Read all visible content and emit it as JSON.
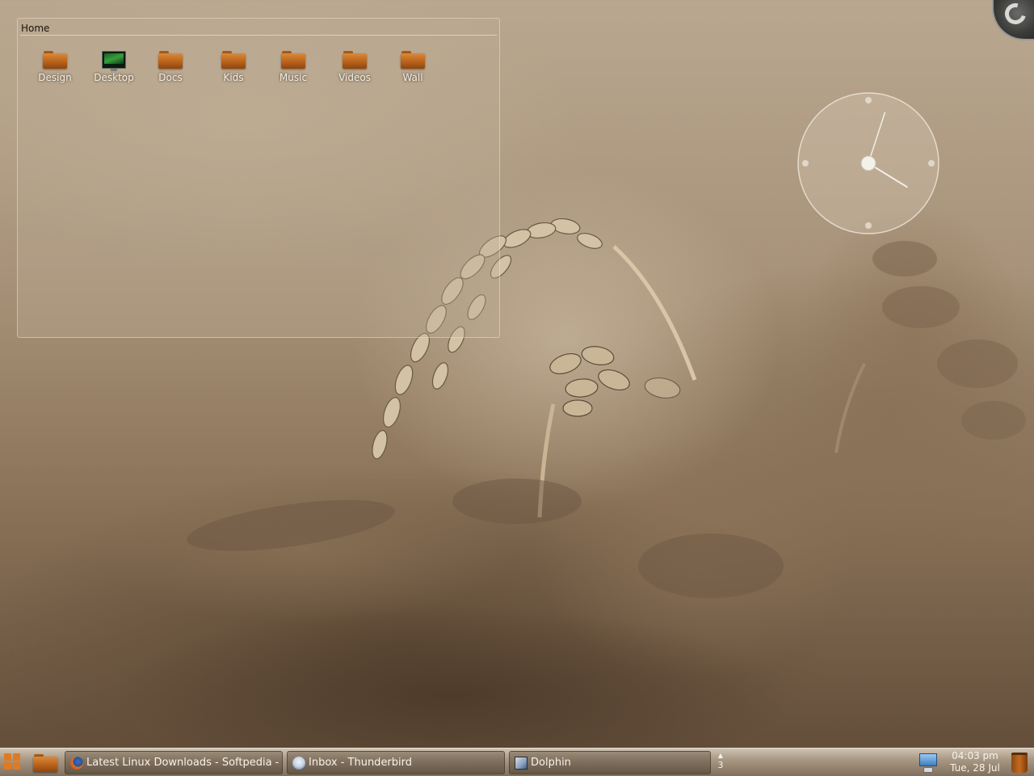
{
  "folderview": {
    "title": "Home",
    "items": [
      {
        "label": "Design",
        "icon": "folder-icon"
      },
      {
        "label": "Desktop",
        "icon": "desktop-screen-icon"
      },
      {
        "label": "Docs",
        "icon": "folder-icon"
      },
      {
        "label": "Kids",
        "icon": "folder-icon"
      },
      {
        "label": "Music",
        "icon": "folder-icon"
      },
      {
        "label": "Videos",
        "icon": "folder-icon"
      },
      {
        "label": "Wall",
        "icon": "folder-icon"
      }
    ]
  },
  "analog_clock": {
    "hour": 4,
    "minute": 3
  },
  "taskbar": {
    "tasks": [
      {
        "label": "Latest Linux Downloads - Softpedia - M",
        "icon": "firefox-icon"
      },
      {
        "label": "Inbox - Thunderbird",
        "icon": "thunderbird-icon"
      },
      {
        "label": "Dolphin",
        "icon": "dolphin-icon"
      }
    ],
    "pager_count": "3",
    "clock_time": "04:03 pm",
    "clock_date": "Tue, 28 Jul"
  },
  "colors": {
    "accent": "#e07a22",
    "folder": "#c46a20"
  }
}
